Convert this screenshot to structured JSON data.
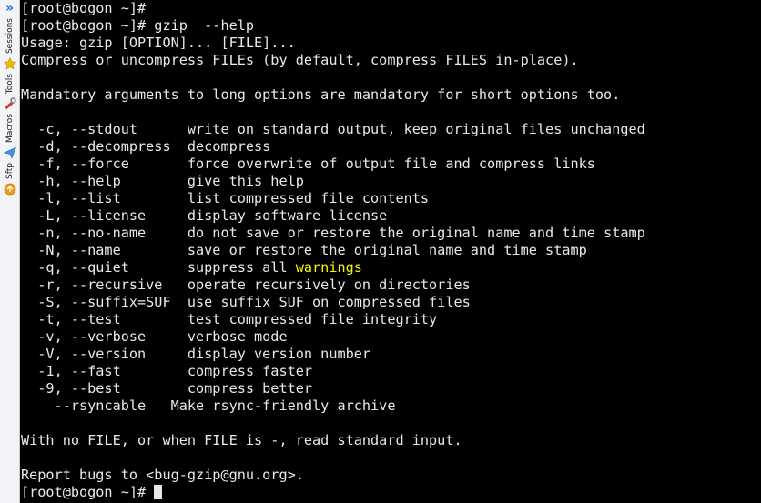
{
  "sidebar": {
    "toggle_glyph": "»",
    "items": [
      {
        "label": "Sessions",
        "icon": "star-icon"
      },
      {
        "label": "Tools",
        "icon": "tools-icon"
      },
      {
        "label": "Macros",
        "icon": "paper-plane-icon"
      },
      {
        "label": "Sftp",
        "icon": "sftp-icon"
      }
    ]
  },
  "terminal": {
    "colors": {
      "background": "#000000",
      "text": "#e8e8e8",
      "highlight": "#f5f500"
    },
    "lines": [
      "[root@bogon ~]#",
      "[root@bogon ~]# gzip  --help",
      "Usage: gzip [OPTION]... [FILE]...",
      "Compress or uncompress FILEs (by default, compress FILES in-place).",
      "",
      "Mandatory arguments to long options are mandatory for short options too.",
      "",
      "  -c, --stdout      write on standard output, keep original files unchanged",
      "  -d, --decompress  decompress",
      "  -f, --force       force overwrite of output file and compress links",
      "  -h, --help        give this help",
      "  -l, --list        list compressed file contents",
      "  -L, --license     display software license",
      "  -n, --no-name     do not save or restore the original name and time stamp",
      "  -N, --name        save or restore the original name and time stamp",
      "  -q, --quiet       suppress all ",
      "  -r, --recursive   operate recursively on directories",
      "  -S, --suffix=SUF  use suffix SUF on compressed files",
      "  -t, --test        test compressed file integrity",
      "  -v, --verbose     verbose mode",
      "  -V, --version     display version number",
      "  -1, --fast        compress faster",
      "  -9, --best        compress better",
      "    --rsyncable   Make rsync-friendly archive",
      "",
      "With no FILE, or when FILE is -, read standard input.",
      "",
      "Report bugs to <bug-gzip@gnu.org>.",
      "[root@bogon ~]# "
    ],
    "highlight_word": "warnings"
  }
}
